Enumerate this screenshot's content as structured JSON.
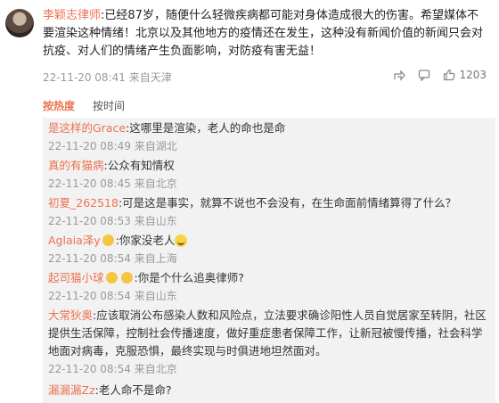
{
  "main": {
    "username": "李颖志律师",
    "text": ":已经87岁，随便什么轻微疾病都可能对身体造成很大的伤害。希望媒体不要渲染这种情绪！北京以及其他地方的疫情还在发生，这种没有新闻价值的新闻只会对抗疫、对人们的情绪产生负面影响，对防疫有害无益！",
    "time": "22-11-20 08:41",
    "source": "来自天津",
    "like_count": "1203"
  },
  "sort": {
    "hot": "按热度",
    "time": "按时间"
  },
  "replies": [
    {
      "name": "是这样的Grace",
      "text": ":这哪里是渲染，老人的命也是命",
      "time": "22-11-20 08:49",
      "source": "来自湖北"
    },
    {
      "name": "真的有猫病",
      "text": ":公众有知情权",
      "time": "22-11-20 08:45",
      "source": "来自北京"
    },
    {
      "name": "初夏_262518",
      "text": ":可是这是事实，就算不说也不会没有，在生命面前情绪算得了什么？",
      "time": "22-11-20 08:53",
      "source": "来自山东"
    },
    {
      "name": "Aglaia泽y",
      "text": ":你家没老人",
      "time": "22-11-20 08:54",
      "source": "来自上海"
    },
    {
      "name": "起司猫小球",
      "text": ":你是个什么追奥律师?",
      "time": "22-11-20 08:54",
      "source": "来自山东"
    },
    {
      "name": "大常狄奥",
      "text": ":应该取消公布感染人数和风险点，立法要求确诊阳性人员自觉居家至转阴，社区提供生活保障，控制社会传播速度，做好重症患者保障工作，让新冠被慢传播，社会科学地面对病毒，克服恐惧，最终实现与时俱进地坦然面对。",
      "time": "22-11-20 08:54",
      "source": "来自北京"
    },
    {
      "name": "漏漏漏Zz",
      "text": ":老人命不是命?"
    }
  ]
}
